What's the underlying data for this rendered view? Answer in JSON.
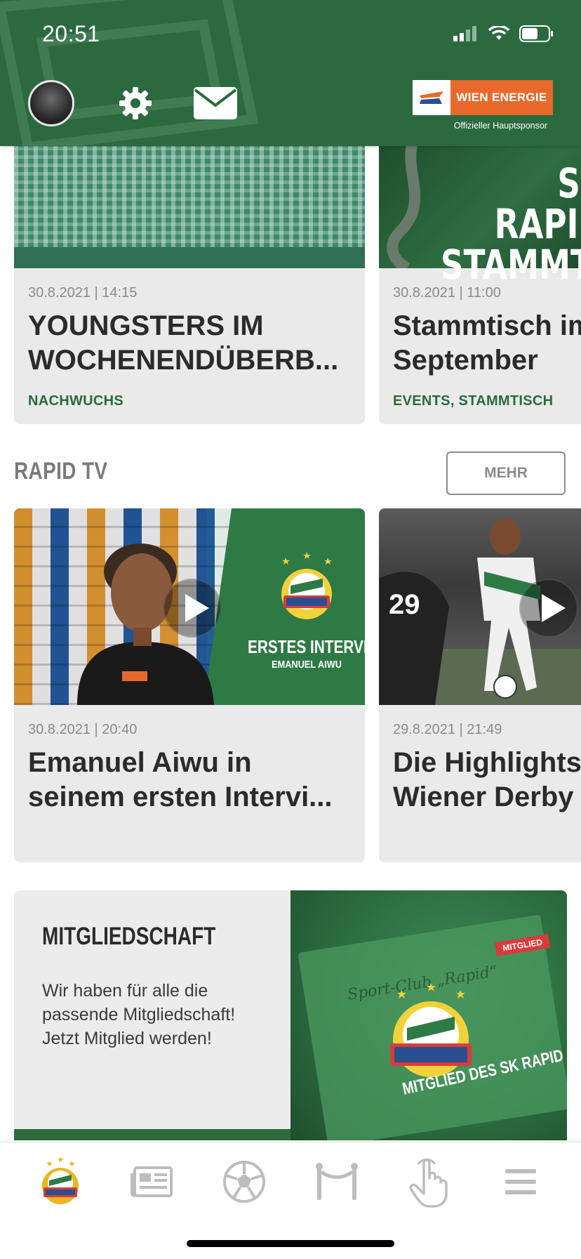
{
  "status_bar": {
    "time": "20:51"
  },
  "header": {
    "sponsor_name": "WIEN ENERGIE",
    "sponsor_subtitle": "Offizieller Hauptsponsor"
  },
  "news": [
    {
      "date": "30.8.2021 | 14:15",
      "title": "YOUNGSTERS IM\nWOCHENENDÜBERB...",
      "category": "NACHWUCHS"
    },
    {
      "date": "30.8.2021 | 11:00",
      "title": "Stammtisch im\nSeptember",
      "category": "EVENTS, STAMMTISCH",
      "image_text": "SK RAPID\nSTAMMTISCH"
    }
  ],
  "rapid_tv": {
    "section_title": "RAPID TV",
    "more_label": "MEHR",
    "videos": [
      {
        "date": "30.8.2021 | 20:40",
        "title": "Emanuel Aiwu in\nseinem ersten Intervi...",
        "image_text_1": "ERSTES INTERVIEW",
        "image_text_2": "EMANUEL AIWU"
      },
      {
        "date": "29.8.2021 | 21:49",
        "title": "Die Highlights\nWiener Derby"
      }
    ]
  },
  "membership": {
    "title": "MITGLIEDSCHAFT",
    "text": "Wir haben für alle die passende Mitgliedschaft! Jetzt Mitglied werden!",
    "image_caption": "MITGLIED DES SK RAPID",
    "image_tag": "MITGLIED",
    "image_script": "Sport-Club „Rapid“"
  },
  "tabbar": {
    "items": [
      {
        "icon": "rapid-logo-icon",
        "active": true
      },
      {
        "icon": "newspaper-icon"
      },
      {
        "icon": "soccer-ball-icon"
      },
      {
        "icon": "goal-icon"
      },
      {
        "icon": "hand-pointer-icon"
      },
      {
        "icon": "menu-icon"
      }
    ]
  },
  "colors": {
    "brand_green": "#2b6a3f",
    "sponsor_orange": "#e8692b",
    "card_bg": "#eaeaea"
  }
}
